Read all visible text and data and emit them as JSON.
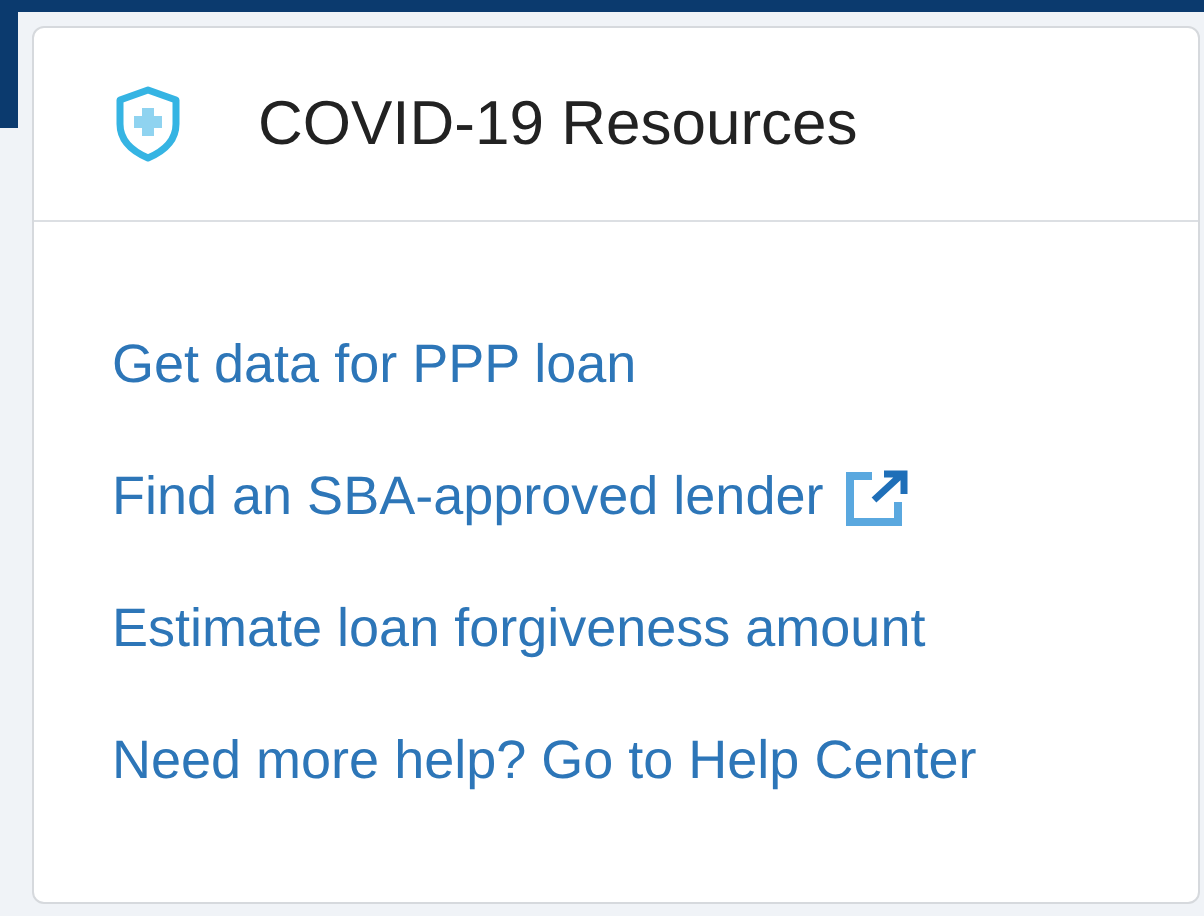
{
  "card": {
    "title": "COVID-19 Resources",
    "links": [
      {
        "label": "Get data for PPP loan",
        "external": false
      },
      {
        "label": "Find an SBA-approved lender",
        "external": true
      },
      {
        "label": "Estimate loan forgiveness amount",
        "external": false
      },
      {
        "label": "Need more help? Go to Help Center",
        "external": false
      }
    ]
  }
}
